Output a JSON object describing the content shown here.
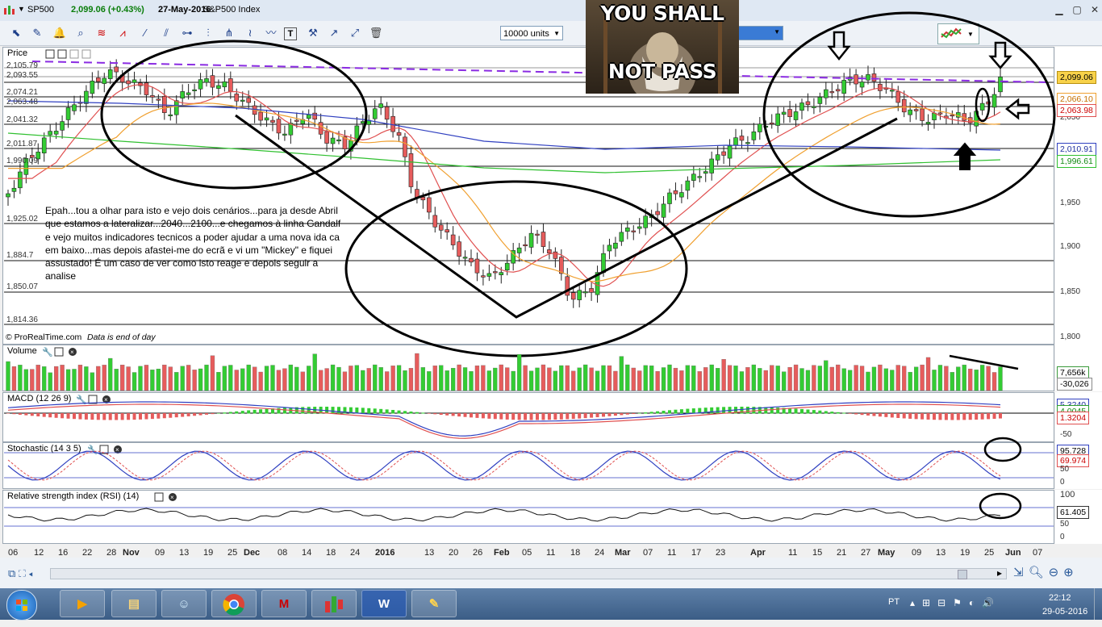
{
  "window": {
    "symbol": "SP500",
    "quote": "2,099.06 (+0.43%)",
    "date": "27-May-2016",
    "instrument": "S&P500 Index",
    "min_icon": "minimize-icon",
    "max_icon": "maximize-icon",
    "close_icon": "close-icon"
  },
  "toolbar": {
    "units_label": "10000 units",
    "icons": [
      "cursor-icon",
      "pencil-icon",
      "alarm-icon",
      "zoom-icon",
      "fibonacci-icon",
      "trend-icon",
      "line-icon",
      "channel-icon",
      "crosshair-icon",
      "text-icon",
      "tools-icon",
      "arrow-icon",
      "trash-icon"
    ]
  },
  "meme": {
    "line1": "YOU SHALL",
    "line2": "NOT PASS"
  },
  "price_panel": {
    "title": "Price",
    "left_labels": [
      "2,105.79",
      "2,093.55",
      "2,074.21",
      "2,063.48",
      "2,041.32",
      "2,011.87",
      "1,990.09",
      "1,925.02",
      "1,884.7",
      "1,850.07",
      "1,814.36"
    ],
    "right_ticks": [
      "2,050",
      "1,950",
      "1,900",
      "1,850",
      "1,800"
    ],
    "tags": {
      "last": "2,099.06",
      "orange": "2,066.10",
      "red": "2,063.98",
      "blue": "2,010.91",
      "green": "1,996.61"
    },
    "footer": "© ProRealTime.com",
    "footer_note": "Data is end of day"
  },
  "annotation_text": "Epah...tou a olhar para isto e vejo dois cenários...para ja desde Abril que estamos a lateralizar...2040...2100...e chegamos à linha Gandalf e vejo muitos indicadores tecnicos a poder ajudar a uma nova ida ca em baixo...mas depois afastei-me do ecrã e vi um \"Mickey\" e fiquei assustado! É um caso de ver como isto reage e depois seguir a analise",
  "volume_panel": {
    "title": "Volume",
    "tag_top": "7,656k",
    "tag_bottom": "-30,026"
  },
  "macd_panel": {
    "title": "MACD (12 26 9)",
    "tag_top": "5.3240",
    "tag_mid": "4.0045",
    "tag_bottom": "1.3204",
    "tick": "-50"
  },
  "stoch_panel": {
    "title": "Stochastic (14 3 5)",
    "tag_top": "95.728",
    "tag_bottom": "69.974",
    "tick_50": "50",
    "tick_0": "0"
  },
  "rsi_panel": {
    "title": "Relative strength index (RSI) (14)",
    "tag": "61.405",
    "tick_100": "100",
    "tick_50": "50",
    "tick_0": "0"
  },
  "x_axis": [
    {
      "t": "06",
      "b": false
    },
    {
      "t": "12",
      "b": false
    },
    {
      "t": "16",
      "b": false
    },
    {
      "t": "22",
      "b": false
    },
    {
      "t": "28",
      "b": false
    },
    {
      "t": "Nov",
      "b": true
    },
    {
      "t": "09",
      "b": false
    },
    {
      "t": "13",
      "b": false
    },
    {
      "t": "19",
      "b": false
    },
    {
      "t": "25",
      "b": false
    },
    {
      "t": "Dec",
      "b": true
    },
    {
      "t": "08",
      "b": false
    },
    {
      "t": "14",
      "b": false
    },
    {
      "t": "18",
      "b": false
    },
    {
      "t": "24",
      "b": false
    },
    {
      "t": "2016",
      "b": true
    },
    {
      "t": "13",
      "b": false
    },
    {
      "t": "20",
      "b": false
    },
    {
      "t": "26",
      "b": false
    },
    {
      "t": "Feb",
      "b": true
    },
    {
      "t": "05",
      "b": false
    },
    {
      "t": "11",
      "b": false
    },
    {
      "t": "18",
      "b": false
    },
    {
      "t": "24",
      "b": false
    },
    {
      "t": "Mar",
      "b": true
    },
    {
      "t": "07",
      "b": false
    },
    {
      "t": "11",
      "b": false
    },
    {
      "t": "17",
      "b": false
    },
    {
      "t": "23",
      "b": false
    },
    {
      "t": "Apr",
      "b": true
    },
    {
      "t": "11",
      "b": false
    },
    {
      "t": "15",
      "b": false
    },
    {
      "t": "21",
      "b": false
    },
    {
      "t": "27",
      "b": false
    },
    {
      "t": "May",
      "b": true
    },
    {
      "t": "09",
      "b": false
    },
    {
      "t": "13",
      "b": false
    },
    {
      "t": "19",
      "b": false
    },
    {
      "t": "25",
      "b": false
    },
    {
      "t": "Jun",
      "b": true
    },
    {
      "t": "07",
      "b": false
    }
  ],
  "taskbar": {
    "apps": [
      "start-orb",
      "video-app",
      "file-explorer",
      "people-app",
      "chrome-browser",
      "mcafee-app",
      "prorealtime-app",
      "word-app",
      "paint-app"
    ],
    "language": "PT",
    "time": "22:12",
    "date": "29-05-2016"
  },
  "colors": {
    "bull": "#33cc33",
    "bear": "#e65c5c",
    "ma_red": "#e05050",
    "ma_orange": "#f0a030",
    "ma_blue": "#3040c0",
    "ma_green": "#30c030",
    "resistance": "#8a2be2"
  }
}
